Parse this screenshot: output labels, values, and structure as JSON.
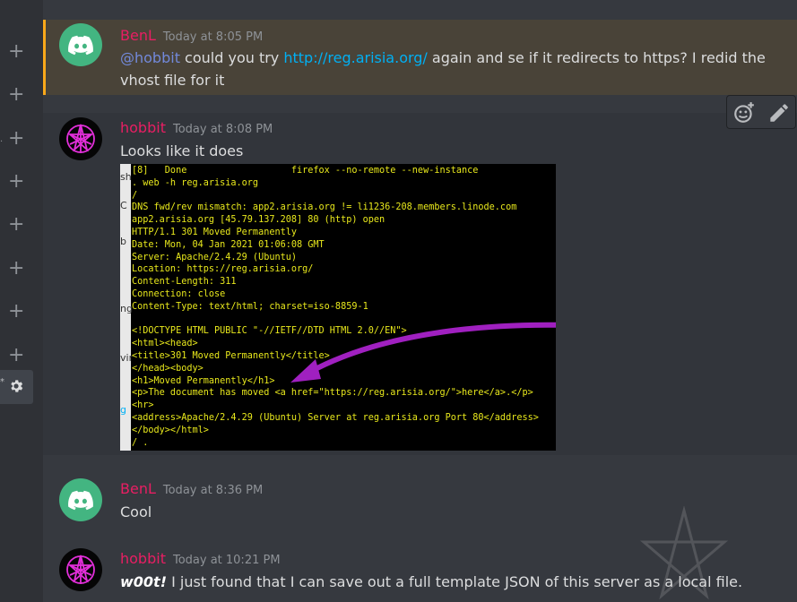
{
  "sidebar": {
    "plus_buttons": [
      "+",
      "+",
      "+",
      "+",
      "+",
      "+",
      "+",
      "+"
    ],
    "settings_icon": "gear-icon"
  },
  "messages": [
    {
      "username": "BenL",
      "timestamp": "Today at 8:05 PM",
      "mention": "@hobbit",
      "text_a": " could you try ",
      "link": "http://reg.arisia.org/",
      "text_b": " again and se if it redirects to https?  I redid the",
      "text_c": "vhost file for it"
    },
    {
      "username": "hobbit",
      "timestamp": "Today at 8:08 PM",
      "text": "Looks like it does",
      "attachment": {
        "terminal_lines": [
          "[8]   Done                   firefox --no-remote --new-instance",
          ". web -h reg.arisia.org",
          "/",
          "DNS fwd/rev mismatch: app2.arisia.org != li1236-208.members.linode.com",
          "app2.arisia.org [45.79.137.208] 80 (http) open",
          "HTTP/1.1 301 Moved Permanently",
          "Date: Mon, 04 Jan 2021 01:06:08 GMT",
          "Server: Apache/2.4.29 (Ubuntu)",
          "Location: https://reg.arisia.org/",
          "Content-Length: 311",
          "Connection: close",
          "Content-Type: text/html; charset=iso-8859-1",
          "",
          "<!DOCTYPE HTML PUBLIC \"-//IETF//DTD HTML 2.0//EN\">",
          "<html><head>",
          "<title>301 Moved Permanently</title>",
          "</head><body>",
          "<h1>Moved Permanently</h1>",
          "<p>The document has moved <a href=\"https://reg.arisia.org/\">here</a>.</p>",
          "<hr>",
          "<address>Apache/2.4.29 (Ubuntu) Server at reg.arisia.org Port 80</address>",
          "</body></html>",
          "/ ."
        ],
        "margin_chars": [
          "sh",
          "C",
          "b",
          "",
          "ng",
          "",
          "vir",
          "g"
        ]
      }
    },
    {
      "username": "BenL",
      "timestamp": "Today at 8:36 PM",
      "text": "Cool"
    },
    {
      "username": "hobbit",
      "timestamp": "Today at 10:21 PM",
      "emphasis": "w00t!",
      "text": " I just found that I can save out a full template JSON of this server as a local file."
    }
  ],
  "toolbar": {
    "add_reaction_icon": "add-reaction-icon",
    "edit_icon": "pencil-icon"
  },
  "colors": {
    "background": "#36393f",
    "username": "#e91e63",
    "mention": "#7289da",
    "link": "#00b0f4",
    "highlight_bar": "#faa81a",
    "terminal_text": "#e8e81c",
    "arrow": "#a020c0"
  }
}
